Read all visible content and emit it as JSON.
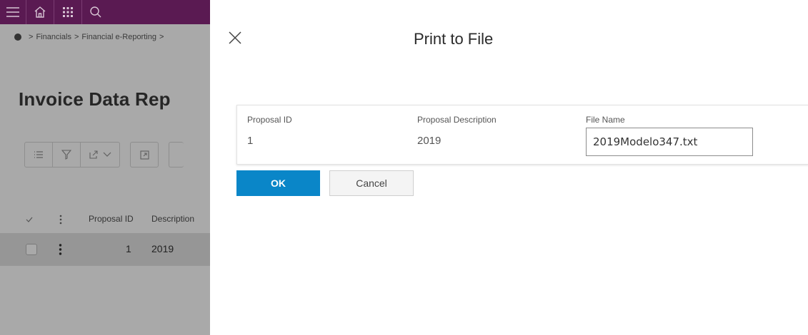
{
  "topbar": {
    "icons": [
      "menu-icon",
      "home-icon",
      "app-grid-icon",
      "search-icon"
    ]
  },
  "breadcrumb": {
    "items": [
      "Financials",
      "Financial e-Reporting"
    ]
  },
  "page": {
    "title": "Invoice Data Rep"
  },
  "toolbar": {
    "icons": [
      "list-icon",
      "filter-icon",
      "export-icon",
      "chevron-down-icon",
      "open-in-icon"
    ]
  },
  "table": {
    "columns": [
      "Proposal ID",
      "Description"
    ],
    "rows": [
      {
        "proposal_id": "1",
        "description": "2019"
      }
    ]
  },
  "dialog": {
    "title": "Print to File",
    "fields": {
      "proposal_id": {
        "label": "Proposal ID",
        "value": "1"
      },
      "proposal_description": {
        "label": "Proposal Description",
        "value": "2019"
      },
      "file_name": {
        "label": "File Name",
        "value": "2019Modelo347.txt"
      }
    },
    "ok_label": "OK",
    "cancel_label": "Cancel"
  },
  "colors": {
    "topbar": "#5a1a52",
    "primary_button": "#0a86c8",
    "overlay": "#a9a9a9"
  }
}
